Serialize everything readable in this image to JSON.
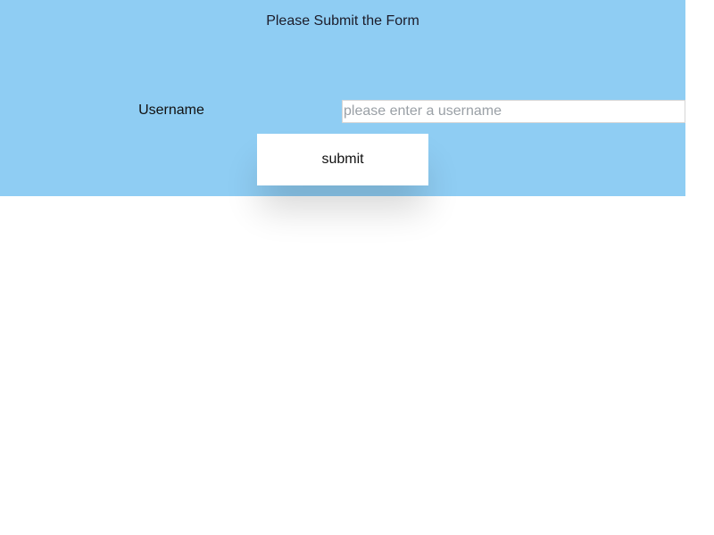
{
  "form": {
    "title": "Please Submit the Form",
    "username_label": "Username",
    "username_value": "",
    "username_placeholder": "please enter a username",
    "submit_label": "submit"
  },
  "colors": {
    "panel_background": "#8fcdf3",
    "page_background": "#ffffff",
    "button_background": "#ffffff",
    "placeholder_text": "#9aa0a6"
  }
}
